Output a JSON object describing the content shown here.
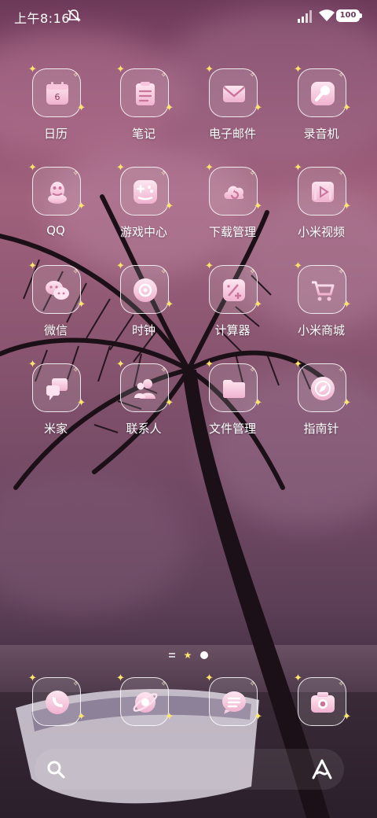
{
  "status_bar": {
    "time": "上午8:16",
    "battery": "100",
    "icons": [
      "mute-icon",
      "signal-icon",
      "wifi-icon",
      "battery-icon"
    ]
  },
  "apps": [
    {
      "label": "日历",
      "icon": "calendar-icon",
      "badge": "6"
    },
    {
      "label": "笔记",
      "icon": "notes-icon"
    },
    {
      "label": "电子邮件",
      "icon": "mail-icon"
    },
    {
      "label": "录音机",
      "icon": "microphone-icon"
    },
    {
      "label": "QQ",
      "icon": "qq-penguin-icon"
    },
    {
      "label": "游戏中心",
      "icon": "gamepad-icon"
    },
    {
      "label": "下载管理",
      "icon": "cloud-download-icon"
    },
    {
      "label": "小米视频",
      "icon": "video-icon"
    },
    {
      "label": "微信",
      "icon": "wechat-icon"
    },
    {
      "label": "时钟",
      "icon": "clock-icon"
    },
    {
      "label": "计算器",
      "icon": "calculator-icon"
    },
    {
      "label": "小米商城",
      "icon": "shopping-cart-icon"
    },
    {
      "label": "米家",
      "icon": "chat-bubbles-icon"
    },
    {
      "label": "联系人",
      "icon": "contacts-icon"
    },
    {
      "label": "文件管理",
      "icon": "folder-icon"
    },
    {
      "label": "指南针",
      "icon": "compass-icon"
    }
  ],
  "dock": [
    {
      "icon": "phone-icon"
    },
    {
      "icon": "browser-planet-icon"
    },
    {
      "icon": "message-icon"
    },
    {
      "icon": "camera-icon"
    }
  ],
  "search_bar": {
    "left_icon": "search-icon",
    "right_icon": "ai-assistant-icon"
  },
  "colors": {
    "accent_pink": "#f2b7d3",
    "sparkle": "#ffe56b"
  }
}
